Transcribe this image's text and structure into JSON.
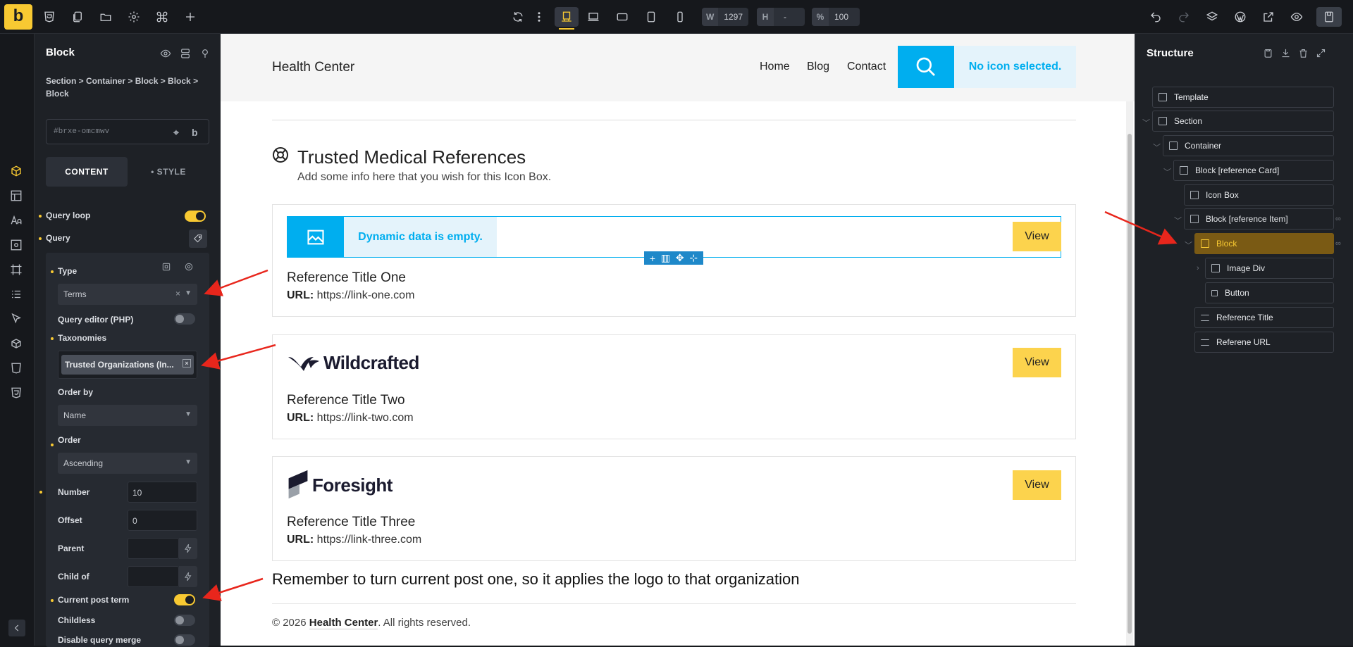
{
  "topbar": {
    "logo": "b",
    "width_label": "W",
    "width_value": "1297",
    "height_label": "H",
    "height_value": "-",
    "zoom_label": "%",
    "zoom_value": "100"
  },
  "panel": {
    "title": "Block",
    "breadcrumb": "Section > Container > Block > Block > Block",
    "element_id": "#brxe-omcmwv",
    "id_suffix": "b",
    "tab_content": "CONTENT",
    "tab_style": "• STYLE",
    "query_loop": "Query loop",
    "query": "Query",
    "type_label": "Type",
    "type_value": "Terms",
    "type_clear": "×",
    "query_editor": "Query editor (PHP)",
    "taxonomies_label": "Taxonomies",
    "taxonomy_chip": "Trusted Organizations (In...",
    "order_by_label": "Order by",
    "order_by_value": "Name",
    "order_label": "Order",
    "order_value": "Ascending",
    "number_label": "Number",
    "number_value": "10",
    "offset_label": "Offset",
    "offset_value": "0",
    "parent_label": "Parent",
    "child_of_label": "Child of",
    "current_post_term": "Current post term",
    "childless": "Childless",
    "disable_query_merge": "Disable query merge"
  },
  "canvas": {
    "site_title": "Health Center",
    "nav": [
      "Home",
      "Blog",
      "Contact"
    ],
    "no_icon": "No icon selected.",
    "iconbox_title": "Trusted Medical References",
    "iconbox_sub": "Add some info here that you wish for this Icon Box.",
    "dynamic_empty": "Dynamic data is empty.",
    "view_label": "View",
    "url_label": "URL:",
    "cards": [
      {
        "logo": "",
        "title": "Reference Title One",
        "url": "https://link-one.com"
      },
      {
        "logo": "Wildcrafted",
        "title": "Reference Title Two",
        "url": "https://link-two.com"
      },
      {
        "logo": "Foresight",
        "title": "Reference Title Three",
        "url": "https://link-three.com"
      }
    ],
    "note": "Remember to turn current post one, so it applies the logo to that organization",
    "footer_pre": "© 2026 ",
    "footer_brand": "Health Center",
    "footer_post": ". All rights reserved."
  },
  "structure": {
    "title": "Structure",
    "nodes": [
      "Template",
      "Section",
      "Container",
      "Block [reference Card]",
      "Icon Box",
      "Block [reference Item]",
      "Block",
      "Image Div",
      "Button",
      "Reference Title",
      "Referene URL"
    ]
  },
  "colors": {
    "accent": "#f8c932",
    "brand_blue": "#00aeef",
    "button_yellow": "#fcd34d",
    "annotation_red": "#e8261c"
  }
}
